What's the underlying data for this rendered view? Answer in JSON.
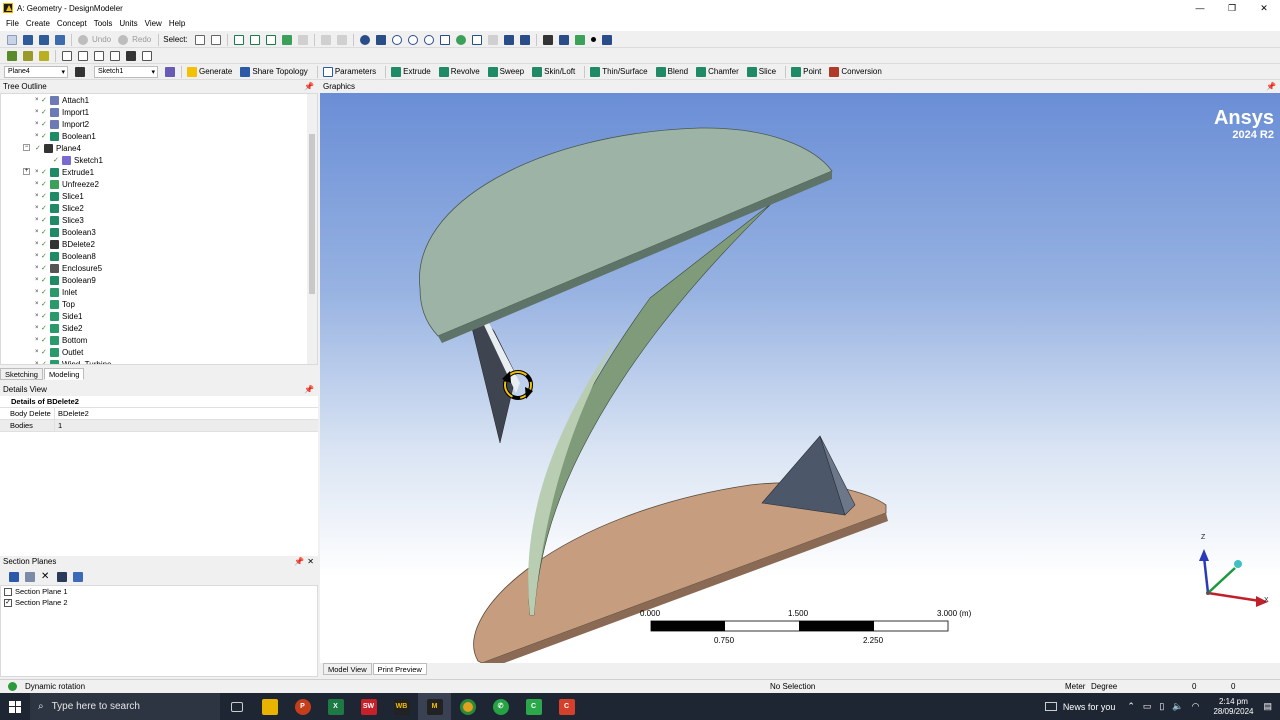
{
  "window": {
    "title": "A: Geometry - DesignModeler",
    "controls": [
      "—",
      "❐",
      "✕"
    ]
  },
  "menu": [
    "File",
    "Create",
    "Concept",
    "Tools",
    "Units",
    "View",
    "Help"
  ],
  "toolbar1": {
    "select_label": "Select:",
    "undo_label": "Undo",
    "redo_label": "Redo"
  },
  "toolbar2": {
    "plane_value": "Plane4",
    "sketch_value": "Sketch1",
    "generate": "Generate",
    "share_topology": "Share Topology",
    "parameters": "Parameters"
  },
  "toolbar3": {
    "extrude": "Extrude",
    "revolve": "Revolve",
    "sweep": "Sweep",
    "skin_loft": "Skin/Loft",
    "thin_surface": "Thin/Surface",
    "blend": "Blend",
    "chamfer": "Chamfer",
    "slice": "Slice",
    "point": "Point",
    "conversion": "Conversion"
  },
  "tree": {
    "header": "Tree Outline",
    "items": [
      {
        "label": "Attach1",
        "icon": "attach-icon",
        "color": "#6a7bb5"
      },
      {
        "label": "Import1",
        "icon": "import-icon",
        "color": "#6a7bb5"
      },
      {
        "label": "Import2",
        "icon": "import-icon",
        "color": "#6a7bb5"
      },
      {
        "label": "Boolean1",
        "icon": "boolean-icon",
        "color": "#1e8a66"
      },
      {
        "label": "Plane4",
        "icon": "plane-icon",
        "color": "#333333"
      },
      {
        "label": "Sketch1",
        "icon": "sketch-icon",
        "color": "#7a6ad0"
      },
      {
        "label": "Extrude1",
        "icon": "extrude-icon",
        "color": "#1e8a66"
      },
      {
        "label": "Unfreeze2",
        "icon": "unfreeze-icon",
        "color": "#3aa05a"
      },
      {
        "label": "Slice1",
        "icon": "slice-icon",
        "color": "#1e8a66"
      },
      {
        "label": "Slice2",
        "icon": "slice-icon",
        "color": "#1e8a66"
      },
      {
        "label": "Slice3",
        "icon": "slice-icon",
        "color": "#1e8a66"
      },
      {
        "label": "Boolean3",
        "icon": "boolean-icon",
        "color": "#1e8a66"
      },
      {
        "label": "BDelete2",
        "icon": "body-delete-icon",
        "color": "#333333"
      },
      {
        "label": "Boolean8",
        "icon": "boolean-icon",
        "color": "#1e8a66"
      },
      {
        "label": "Enclosure5",
        "icon": "enclosure-icon",
        "color": "#555555"
      },
      {
        "label": "Boolean9",
        "icon": "boolean-icon",
        "color": "#1e8a66"
      },
      {
        "label": "Inlet",
        "icon": "named-selection-icon",
        "color": "#2a9a6a"
      },
      {
        "label": "Top",
        "icon": "named-selection-icon",
        "color": "#2a9a6a"
      },
      {
        "label": "Side1",
        "icon": "named-selection-icon",
        "color": "#2a9a6a"
      },
      {
        "label": "Side2",
        "icon": "named-selection-icon",
        "color": "#2a9a6a"
      },
      {
        "label": "Bottom",
        "icon": "named-selection-icon",
        "color": "#2a9a6a"
      },
      {
        "label": "Outlet",
        "icon": "named-selection-icon",
        "color": "#2a9a6a"
      },
      {
        "label": "Wind_Turbine",
        "icon": "named-selection-icon",
        "color": "#2a9a6a"
      }
    ]
  },
  "tabs": [
    "Sketching",
    "Modeling"
  ],
  "details": {
    "header": "Details View",
    "title": "Details of BDelete2",
    "rows": [
      {
        "key": "Body Delete",
        "value": "BDelete2"
      },
      {
        "key": "Bodies",
        "value": "1"
      }
    ]
  },
  "section_planes": {
    "header": "Section Planes",
    "items": [
      {
        "label": "Section Plane 1",
        "checked": false
      },
      {
        "label": "Section Plane 2",
        "checked": true
      }
    ]
  },
  "graphics": {
    "header": "Graphics",
    "logo_brand": "Ansys",
    "logo_version": "2024 R2",
    "scale": {
      "labels_top": [
        "0.000",
        "1.500",
        "3.000 (m)"
      ],
      "labels_bottom": [
        "0.750",
        "2.250"
      ]
    },
    "triad": {
      "z": "Z",
      "x": "X"
    }
  },
  "bottom_tabs": [
    "Model View",
    "Print Preview"
  ],
  "status": {
    "mode": "Dynamic rotation",
    "selection": "No Selection",
    "units_len": "Meter",
    "units_ang": "Degree",
    "val1": "0",
    "val2": "0"
  },
  "taskbar": {
    "search_placeholder": "Type here to search",
    "news": "News for you",
    "time": "2:14 pm",
    "date": "28/09/2024"
  }
}
